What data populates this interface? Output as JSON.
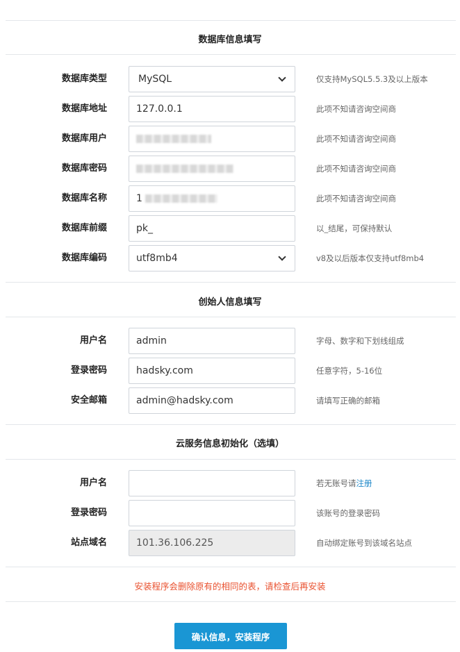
{
  "db_section": {
    "title": "数据库信息填写",
    "type": {
      "label": "数据库类型",
      "value": "MySQL",
      "hint": "仅支持MySQL5.5.3及以上版本"
    },
    "host": {
      "label": "数据库地址",
      "value": "127.0.0.1",
      "hint": "此项不知请咨询空间商"
    },
    "user": {
      "label": "数据库用户",
      "hint": "此项不知请咨询空间商"
    },
    "password": {
      "label": "数据库密码",
      "hint": "此项不知请咨询空间商"
    },
    "name": {
      "label": "数据库名称",
      "value_prefix": "1",
      "hint": "此项不知请咨询空间商"
    },
    "prefix": {
      "label": "数据库前缀",
      "value": "pk_",
      "hint": "以_结尾，可保持默认"
    },
    "charset": {
      "label": "数据库编码",
      "value": "utf8mb4",
      "hint": "v8及以后版本仅支持utf8mb4"
    }
  },
  "founder_section": {
    "title": "创始人信息填写",
    "username": {
      "label": "用户名",
      "value": "admin",
      "hint": "字母、数字和下划线组成"
    },
    "password": {
      "label": "登录密码",
      "value": "hadsky.com",
      "hint": "任意字符，5-16位"
    },
    "email": {
      "label": "安全邮箱",
      "value": "admin@hadsky.com",
      "hint": "请填写正确的邮箱"
    }
  },
  "cloud_section": {
    "title": "云服务信息初始化（选填）",
    "username": {
      "label": "用户名",
      "value": "",
      "hint_prefix": "若无账号请",
      "hint_link": "注册"
    },
    "password": {
      "label": "登录密码",
      "value": "",
      "hint": "该账号的登录密码"
    },
    "domain": {
      "label": "站点域名",
      "value": "101.36.106.225",
      "hint": "自动绑定账号到该域名站点"
    }
  },
  "warning": "安装程序会删除原有的相同的表，请检查后再安装",
  "submit_label": "确认信息，安装程序",
  "colors": {
    "accent": "#1a96d4",
    "warning": "#e9512f",
    "link": "#1e88c8"
  }
}
